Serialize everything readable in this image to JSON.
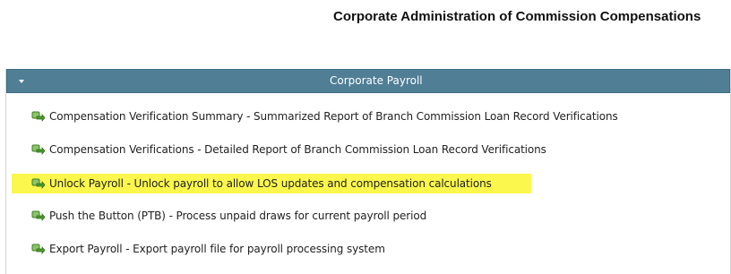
{
  "page": {
    "title": "Corporate Administration of Commission Compensations"
  },
  "panel": {
    "title": "Corporate Payroll",
    "items": [
      {
        "label": "Compensation Verification Summary - Summarized Report of Branch Commission Loan Record Verifications",
        "highlighted": false
      },
      {
        "label": "Compensation Verifications - Detailed Report of Branch Commission Loan Record Verifications",
        "highlighted": false
      },
      {
        "label": "Unlock Payroll - Unlock payroll to allow LOS updates and compensation calculations",
        "highlighted": true
      },
      {
        "label": "Push the Button (PTB) - Process unpaid draws for current payroll period",
        "highlighted": false
      },
      {
        "label": "Export Payroll - Export payroll file for payroll processing system",
        "highlighted": false
      }
    ]
  },
  "colors": {
    "header_bg": "#4f7e95",
    "highlight": "#fbf74c",
    "icon_green": "#4a9a2c"
  },
  "icons": {
    "item_icon": "green-link-arrow-icon",
    "toggle_icon": "caret-down-icon"
  }
}
